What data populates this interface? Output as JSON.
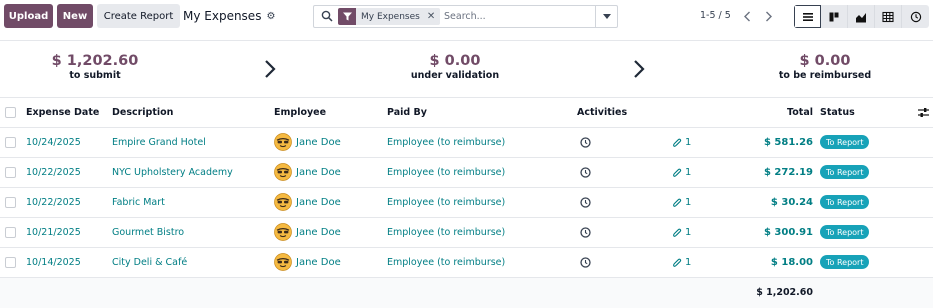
{
  "toolbar": {
    "upload_label": "Upload",
    "new_label": "New",
    "create_report_label": "Create Report",
    "title": "My Expenses"
  },
  "search": {
    "facet_label": "My Expenses",
    "placeholder": "Search..."
  },
  "pager": {
    "value": "1-5 / 5"
  },
  "views": [
    "list-view",
    "kanban-view",
    "graph-view",
    "pivot-view",
    "activity-view"
  ],
  "summary": [
    {
      "amount": "$ 1,202.60",
      "label": "to submit"
    },
    {
      "amount": "$ 0.00",
      "label": "under validation"
    },
    {
      "amount": "$ 0.00",
      "label": "to be reimbursed"
    }
  ],
  "table": {
    "headers": {
      "date": "Expense Date",
      "description": "Description",
      "employee": "Employee",
      "paid_by": "Paid By",
      "activities": "Activities",
      "total": "Total",
      "status": "Status"
    },
    "rows": [
      {
        "date": "10/24/2025",
        "description": "Empire Grand Hotel",
        "employee": "Jane Doe",
        "paid_by": "Employee (to reimburse)",
        "attachments": "1",
        "total": "$ 581.26",
        "status": "To Report"
      },
      {
        "date": "10/22/2025",
        "description": "NYC Upholstery Academy",
        "employee": "Jane Doe",
        "paid_by": "Employee (to reimburse)",
        "attachments": "1",
        "total": "$ 272.19",
        "status": "To Report"
      },
      {
        "date": "10/22/2025",
        "description": "Fabric Mart",
        "employee": "Jane Doe",
        "paid_by": "Employee (to reimburse)",
        "attachments": "1",
        "total": "$ 30.24",
        "status": "To Report"
      },
      {
        "date": "10/21/2025",
        "description": "Gourmet Bistro",
        "employee": "Jane Doe",
        "paid_by": "Employee (to reimburse)",
        "attachments": "1",
        "total": "$ 300.91",
        "status": "To Report"
      },
      {
        "date": "10/14/2025",
        "description": "City Deli & Café",
        "employee": "Jane Doe",
        "paid_by": "Employee (to reimburse)",
        "attachments": "1",
        "total": "$ 18.00",
        "status": "To Report"
      }
    ],
    "grand_total": "$ 1,202.60"
  },
  "colors": {
    "brand": "#714b67",
    "link": "#017e84",
    "badge": "#17a2b8"
  }
}
